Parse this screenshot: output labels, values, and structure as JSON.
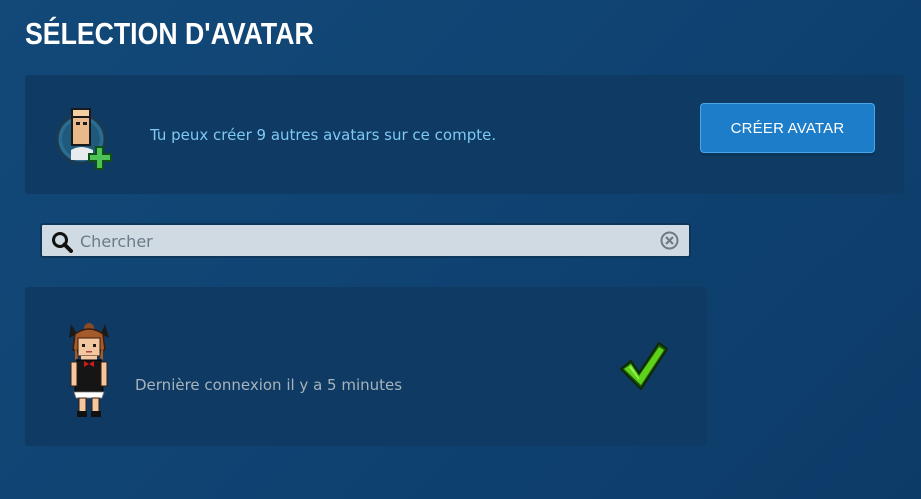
{
  "header": {
    "title": "SÉLECTION D'AVATAR"
  },
  "create": {
    "info_text": "Tu peux créer 9 autres avatars sur ce compte.",
    "button_label": "CRÉER AVATAR",
    "icon": "avatar-add-icon"
  },
  "search": {
    "placeholder": "Chercher",
    "value": "",
    "icon": "search-icon",
    "clear_icon": "clear-icon"
  },
  "avatars": [
    {
      "last_login": "Dernière connexion il y a 5 minutes",
      "selected": true,
      "status_icon": "checkmark-icon"
    }
  ],
  "colors": {
    "background": "#0f4271",
    "panel": "#0e3a63",
    "accent_button": "#1d7dc8",
    "info_text": "#7ec9f2",
    "check": "#5ed11a"
  }
}
